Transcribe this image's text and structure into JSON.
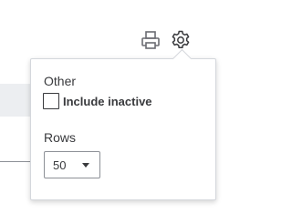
{
  "toolbar": {
    "icons": [
      "printer-icon",
      "gear-icon"
    ]
  },
  "settings_popover": {
    "other_heading": "Other",
    "include_inactive": {
      "label": "Include inactive",
      "checked": false
    },
    "rows_heading": "Rows",
    "rows_select": {
      "value": "50"
    }
  },
  "colors": {
    "text": "#393a3d",
    "border": "#d4d7dc",
    "icon": "#6b6c72",
    "background_band": "#eceef1"
  }
}
